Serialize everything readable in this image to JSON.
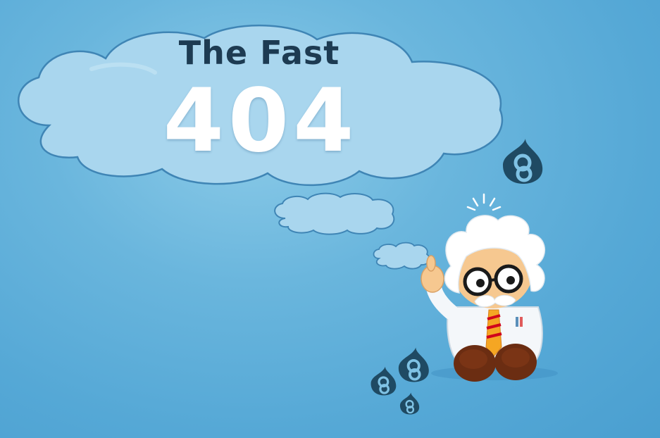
{
  "page": {
    "title_text": "The Fast",
    "code_text": "404"
  },
  "icons": {
    "thought_cloud": "thought-cloud",
    "small_bubbles": "thought-bubbles",
    "character": "einstein-scientist-mascot",
    "logos": "drupal-8-logo"
  },
  "colors": {
    "background": "#5aaad6",
    "cloud_fill": "#a9d6ee",
    "cloud_stroke": "#3f85b5",
    "title_color": "#1d3b52",
    "code_color": "#ffffff",
    "logo_color": "#1f4a63"
  }
}
